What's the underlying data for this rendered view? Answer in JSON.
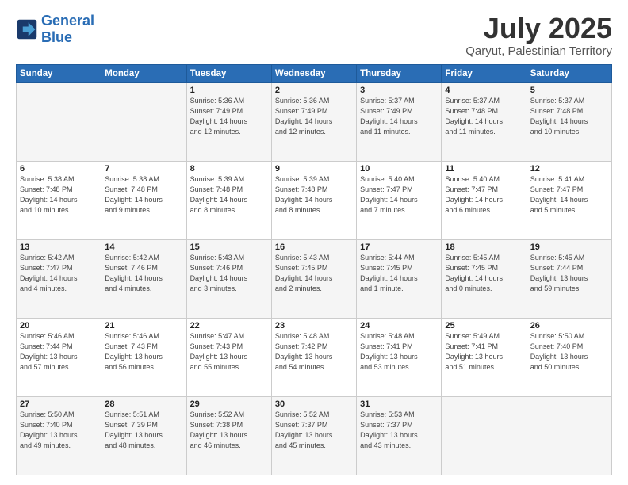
{
  "header": {
    "logo_general": "General",
    "logo_blue": "Blue",
    "month": "July 2025",
    "location": "Qaryut, Palestinian Territory"
  },
  "weekdays": [
    "Sunday",
    "Monday",
    "Tuesday",
    "Wednesday",
    "Thursday",
    "Friday",
    "Saturday"
  ],
  "weeks": [
    [
      {
        "day": "",
        "detail": ""
      },
      {
        "day": "",
        "detail": ""
      },
      {
        "day": "1",
        "detail": "Sunrise: 5:36 AM\nSunset: 7:49 PM\nDaylight: 14 hours\nand 12 minutes."
      },
      {
        "day": "2",
        "detail": "Sunrise: 5:36 AM\nSunset: 7:49 PM\nDaylight: 14 hours\nand 12 minutes."
      },
      {
        "day": "3",
        "detail": "Sunrise: 5:37 AM\nSunset: 7:49 PM\nDaylight: 14 hours\nand 11 minutes."
      },
      {
        "day": "4",
        "detail": "Sunrise: 5:37 AM\nSunset: 7:48 PM\nDaylight: 14 hours\nand 11 minutes."
      },
      {
        "day": "5",
        "detail": "Sunrise: 5:37 AM\nSunset: 7:48 PM\nDaylight: 14 hours\nand 10 minutes."
      }
    ],
    [
      {
        "day": "6",
        "detail": "Sunrise: 5:38 AM\nSunset: 7:48 PM\nDaylight: 14 hours\nand 10 minutes."
      },
      {
        "day": "7",
        "detail": "Sunrise: 5:38 AM\nSunset: 7:48 PM\nDaylight: 14 hours\nand 9 minutes."
      },
      {
        "day": "8",
        "detail": "Sunrise: 5:39 AM\nSunset: 7:48 PM\nDaylight: 14 hours\nand 8 minutes."
      },
      {
        "day": "9",
        "detail": "Sunrise: 5:39 AM\nSunset: 7:48 PM\nDaylight: 14 hours\nand 8 minutes."
      },
      {
        "day": "10",
        "detail": "Sunrise: 5:40 AM\nSunset: 7:47 PM\nDaylight: 14 hours\nand 7 minutes."
      },
      {
        "day": "11",
        "detail": "Sunrise: 5:40 AM\nSunset: 7:47 PM\nDaylight: 14 hours\nand 6 minutes."
      },
      {
        "day": "12",
        "detail": "Sunrise: 5:41 AM\nSunset: 7:47 PM\nDaylight: 14 hours\nand 5 minutes."
      }
    ],
    [
      {
        "day": "13",
        "detail": "Sunrise: 5:42 AM\nSunset: 7:47 PM\nDaylight: 14 hours\nand 4 minutes."
      },
      {
        "day": "14",
        "detail": "Sunrise: 5:42 AM\nSunset: 7:46 PM\nDaylight: 14 hours\nand 4 minutes."
      },
      {
        "day": "15",
        "detail": "Sunrise: 5:43 AM\nSunset: 7:46 PM\nDaylight: 14 hours\nand 3 minutes."
      },
      {
        "day": "16",
        "detail": "Sunrise: 5:43 AM\nSunset: 7:45 PM\nDaylight: 14 hours\nand 2 minutes."
      },
      {
        "day": "17",
        "detail": "Sunrise: 5:44 AM\nSunset: 7:45 PM\nDaylight: 14 hours\nand 1 minute."
      },
      {
        "day": "18",
        "detail": "Sunrise: 5:45 AM\nSunset: 7:45 PM\nDaylight: 14 hours\nand 0 minutes."
      },
      {
        "day": "19",
        "detail": "Sunrise: 5:45 AM\nSunset: 7:44 PM\nDaylight: 13 hours\nand 59 minutes."
      }
    ],
    [
      {
        "day": "20",
        "detail": "Sunrise: 5:46 AM\nSunset: 7:44 PM\nDaylight: 13 hours\nand 57 minutes."
      },
      {
        "day": "21",
        "detail": "Sunrise: 5:46 AM\nSunset: 7:43 PM\nDaylight: 13 hours\nand 56 minutes."
      },
      {
        "day": "22",
        "detail": "Sunrise: 5:47 AM\nSunset: 7:43 PM\nDaylight: 13 hours\nand 55 minutes."
      },
      {
        "day": "23",
        "detail": "Sunrise: 5:48 AM\nSunset: 7:42 PM\nDaylight: 13 hours\nand 54 minutes."
      },
      {
        "day": "24",
        "detail": "Sunrise: 5:48 AM\nSunset: 7:41 PM\nDaylight: 13 hours\nand 53 minutes."
      },
      {
        "day": "25",
        "detail": "Sunrise: 5:49 AM\nSunset: 7:41 PM\nDaylight: 13 hours\nand 51 minutes."
      },
      {
        "day": "26",
        "detail": "Sunrise: 5:50 AM\nSunset: 7:40 PM\nDaylight: 13 hours\nand 50 minutes."
      }
    ],
    [
      {
        "day": "27",
        "detail": "Sunrise: 5:50 AM\nSunset: 7:40 PM\nDaylight: 13 hours\nand 49 minutes."
      },
      {
        "day": "28",
        "detail": "Sunrise: 5:51 AM\nSunset: 7:39 PM\nDaylight: 13 hours\nand 48 minutes."
      },
      {
        "day": "29",
        "detail": "Sunrise: 5:52 AM\nSunset: 7:38 PM\nDaylight: 13 hours\nand 46 minutes."
      },
      {
        "day": "30",
        "detail": "Sunrise: 5:52 AM\nSunset: 7:37 PM\nDaylight: 13 hours\nand 45 minutes."
      },
      {
        "day": "31",
        "detail": "Sunrise: 5:53 AM\nSunset: 7:37 PM\nDaylight: 13 hours\nand 43 minutes."
      },
      {
        "day": "",
        "detail": ""
      },
      {
        "day": "",
        "detail": ""
      }
    ]
  ]
}
